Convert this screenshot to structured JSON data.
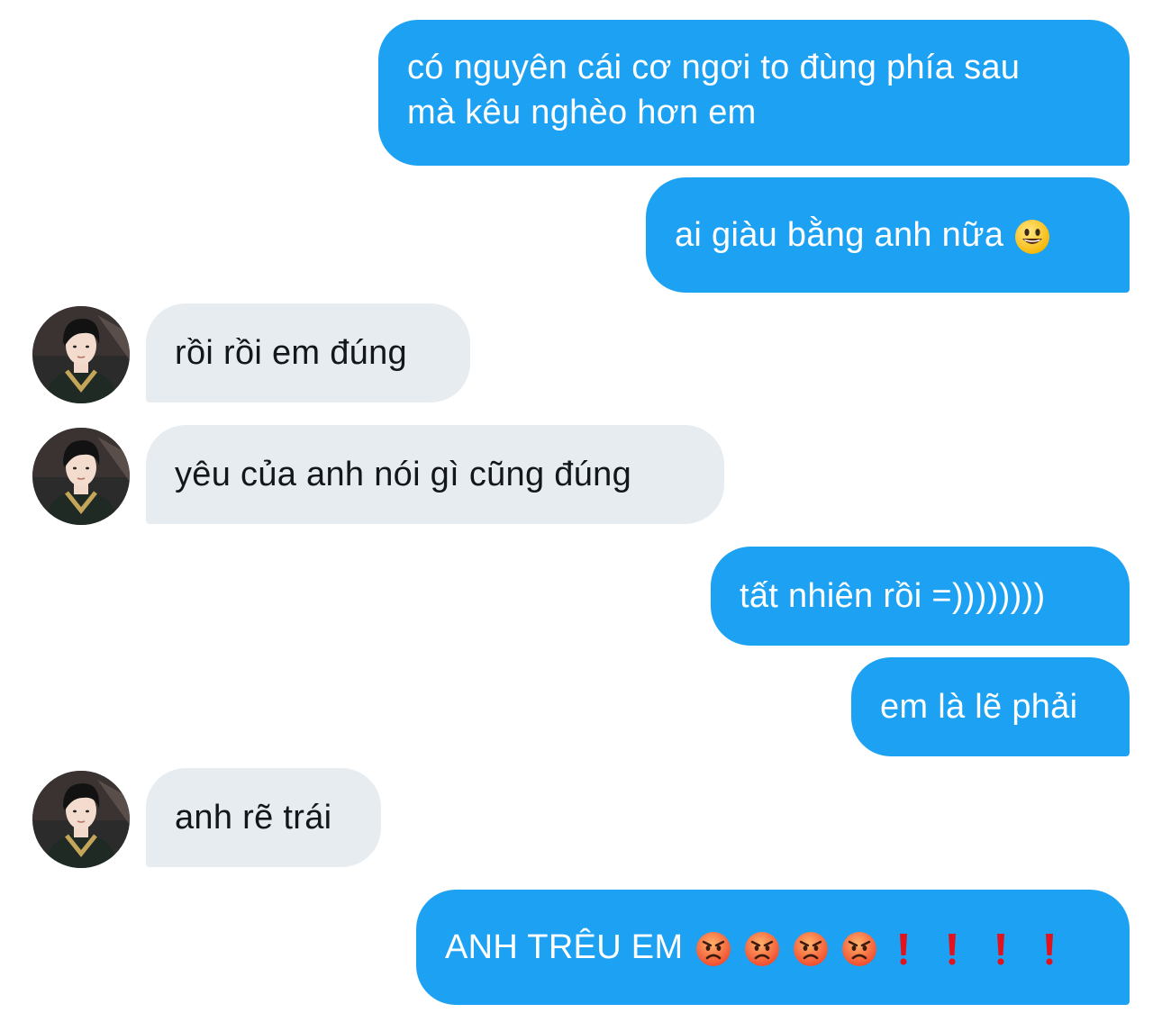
{
  "messages": [
    {
      "from": "me",
      "lines": [
        "có nguyên cái cơ ngơi to đùng phía sau",
        "mà kêu nghèo hơn em"
      ]
    },
    {
      "from": "me",
      "text": "ai giàu bằng anh nữa",
      "emoji": "smiley-face-icon"
    },
    {
      "from": "them",
      "text": "rồi rồi em đúng"
    },
    {
      "from": "them",
      "text": "yêu của anh nói gì cũng đúng"
    },
    {
      "from": "me",
      "text": "tất nhiên rồi =))))))))"
    },
    {
      "from": "me",
      "text": "em là lẽ phải"
    },
    {
      "from": "them",
      "text": "anh rẽ trái"
    },
    {
      "from": "me",
      "text": "ANH TRÊU EM",
      "emojis": [
        "pouting-face-icon",
        "pouting-face-icon",
        "pouting-face-icon",
        "pouting-face-icon",
        "exclamation-mark-icon",
        "exclamation-mark-icon",
        "exclamation-mark-icon",
        "exclamation-mark-icon"
      ]
    }
  ],
  "colors": {
    "sent_bubble": "#1da1f2",
    "received_bubble": "#e6ecf0",
    "sent_text": "#ffffff",
    "received_text": "#14171a"
  }
}
